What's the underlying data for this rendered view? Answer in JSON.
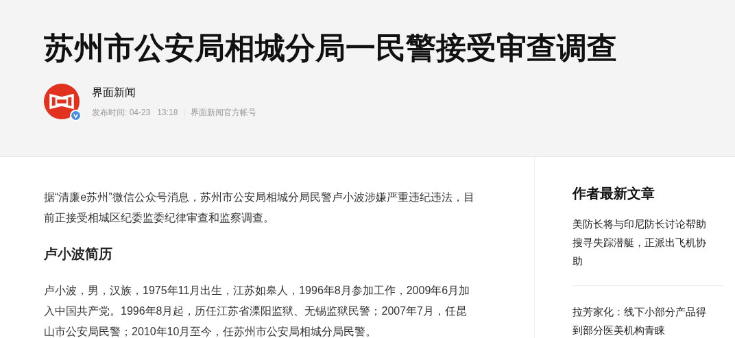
{
  "headline": "苏州市公安局相城分局一民警接受审查调查",
  "author": {
    "name": "界面新闻",
    "verified": true,
    "published_label": "发布时间: 04-23",
    "time": "13:18",
    "account_type": "界面新闻官方帐号"
  },
  "article": [
    {
      "kind": "paragraph",
      "text": "据“清廉e苏州”微信公众号消息，苏州市公安局相城分局民警卢小波涉嫌严重违纪违法，目前正接受相城区纪委监委纪律审查和监察调查。"
    },
    {
      "kind": "heading",
      "text": "卢小波简历"
    },
    {
      "kind": "paragraph",
      "text": "卢小波，男，汉族，1975年11月出生，江苏如皋人，1996年8月参加工作，2009年6月加入中国共产党。1996年8月起，历任江苏省溧阳监狱、无锡监狱民警；2007年7月，任昆山市公安局民警；2010年10月至今，任苏州市公安局相城分局民警。"
    }
  ],
  "sidebar": {
    "title": "作者最新文章",
    "articles": [
      "美防长将与印尼防长讨论帮助搜寻失踪潜艇，正派出飞机协助",
      "拉芳家化：线下小部分产品得到部分医美机构青睐"
    ]
  }
}
